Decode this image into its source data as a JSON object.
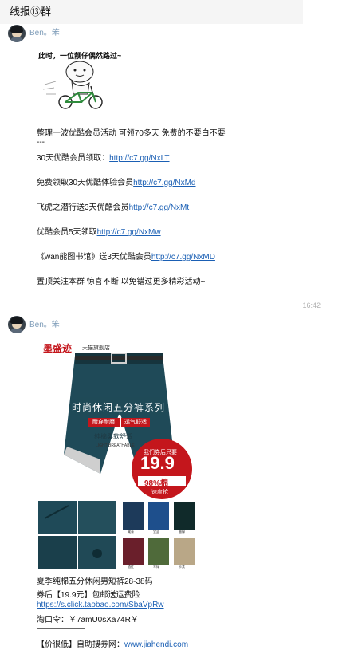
{
  "header": {
    "title": "线报⑬群"
  },
  "messages": [
    {
      "sender": "Ben。笨",
      "sticker_caption": "此时，一位靓仔偶然路过~",
      "lines": [
        {
          "text": "整理一波优酷会员活动 可领70多天 免费的不要白不要"
        },
        {
          "text": "---"
        },
        {
          "text": "30天优酷会员领取：",
          "link": "http://c7.gg/NxLT"
        },
        {
          "text": "免费领取30天优酷体验会员",
          "link": "http://c7.gg/NxMd"
        },
        {
          "text": "飞虎之潜行送3天优酷会员",
          "link": "http://c7.gg/NxMt"
        },
        {
          "text": "优酷会员5天领取",
          "link": "http://c7.gg/NxMw"
        },
        {
          "text": "《wan能图书馆》送3天优酷会员",
          "link": "http://c7.gg/NxMD"
        },
        {
          "text": "置顶关注本群 惊喜不断 以免错过更多精彩活动~"
        }
      ]
    },
    {
      "timestamp": "16:42",
      "sender": "Ben。笨",
      "product_image": {
        "brand": "墨盛迹",
        "brand_sub": "天猫旗舰店",
        "series_title": "时尚休闲五分裤系列",
        "tag1": "耐穿耐磨",
        "tag2": "透气舒适",
        "sub_text": "纯棉柔软舒适",
        "sub_text_en": "LIGHT BREATHABLE",
        "badge_top": "我们券后只要",
        "price": "19.9",
        "badge_pct": "98%棉",
        "badge_bottom": "速度抢",
        "swatch_labels": [
          "藏青",
          "宝蓝",
          "墨绿",
          "酒红",
          "军绿",
          "卡其"
        ]
      },
      "lines": [
        {
          "text": "夏季纯棉五分休闲男短裤28-38码"
        },
        {
          "text": "券后【19.9元】包邮送运费险"
        },
        {
          "text": "",
          "link": "https://s.click.taobao.com/SbaVpRw"
        },
        {
          "text": "淘口令：￥7amU0sXa74R￥"
        },
        {
          "text": "——————"
        },
        {
          "text": "【价很低】自助搜券网：",
          "link": "www.jiahendi.com"
        }
      ]
    }
  ],
  "colors": {
    "sender": "#7f9db9",
    "link": "#1a5fb4",
    "brand_red": "#c4161c",
    "pants_teal": "#1f4a58"
  },
  "icons": [
    "avatar-image"
  ]
}
